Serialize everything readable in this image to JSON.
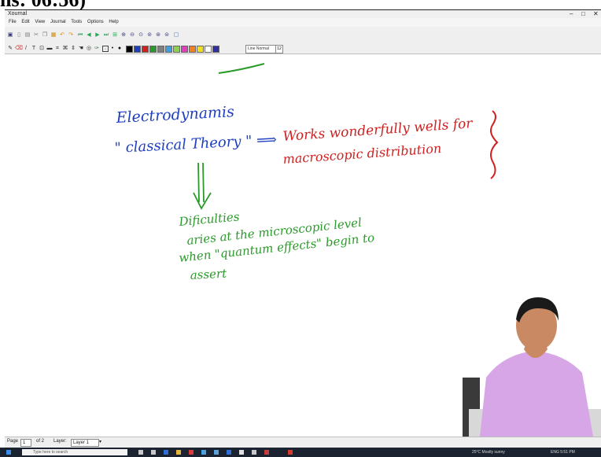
{
  "caption": {
    "text": "ns: 06:56)"
  },
  "window": {
    "title": "Xournal",
    "minimize": "–",
    "maximize": "□",
    "close": "✕"
  },
  "menu": [
    "File",
    "Edit",
    "View",
    "Journal",
    "Tools",
    "Options",
    "Help"
  ],
  "toolbar": {
    "pen_size_label": "Line Normal",
    "pen_size_value": "12",
    "palette": [
      "#000000",
      "#1f3fbf",
      "#d02020",
      "#2a9a2a",
      "#7f7f7f",
      "#3fa0e0",
      "#8fd04f",
      "#e040c0",
      "#f08020",
      "#f0e020",
      "#ffffff",
      "#3030a0"
    ]
  },
  "notes": {
    "line1": "Electrodynamis",
    "line2": "\" classical Theory \" ⟹",
    "red1": "Works wonderfully wells for",
    "red2": "macroscopic distribution",
    "green1": "Dificulties",
    "green2": "aries at the microscopic level",
    "green3": "when \"quantum effects\" begin to",
    "green4": "assert"
  },
  "status": {
    "page_label": "Page",
    "page_value": "1",
    "of_pages": "of 2",
    "layer_label": "Layer:",
    "layer_value": "Layer 1"
  },
  "taskbar": {
    "search_placeholder": "Type here to search",
    "weather": "25°C  Mostly sunny",
    "tray": "ENG  5:51 PM"
  }
}
